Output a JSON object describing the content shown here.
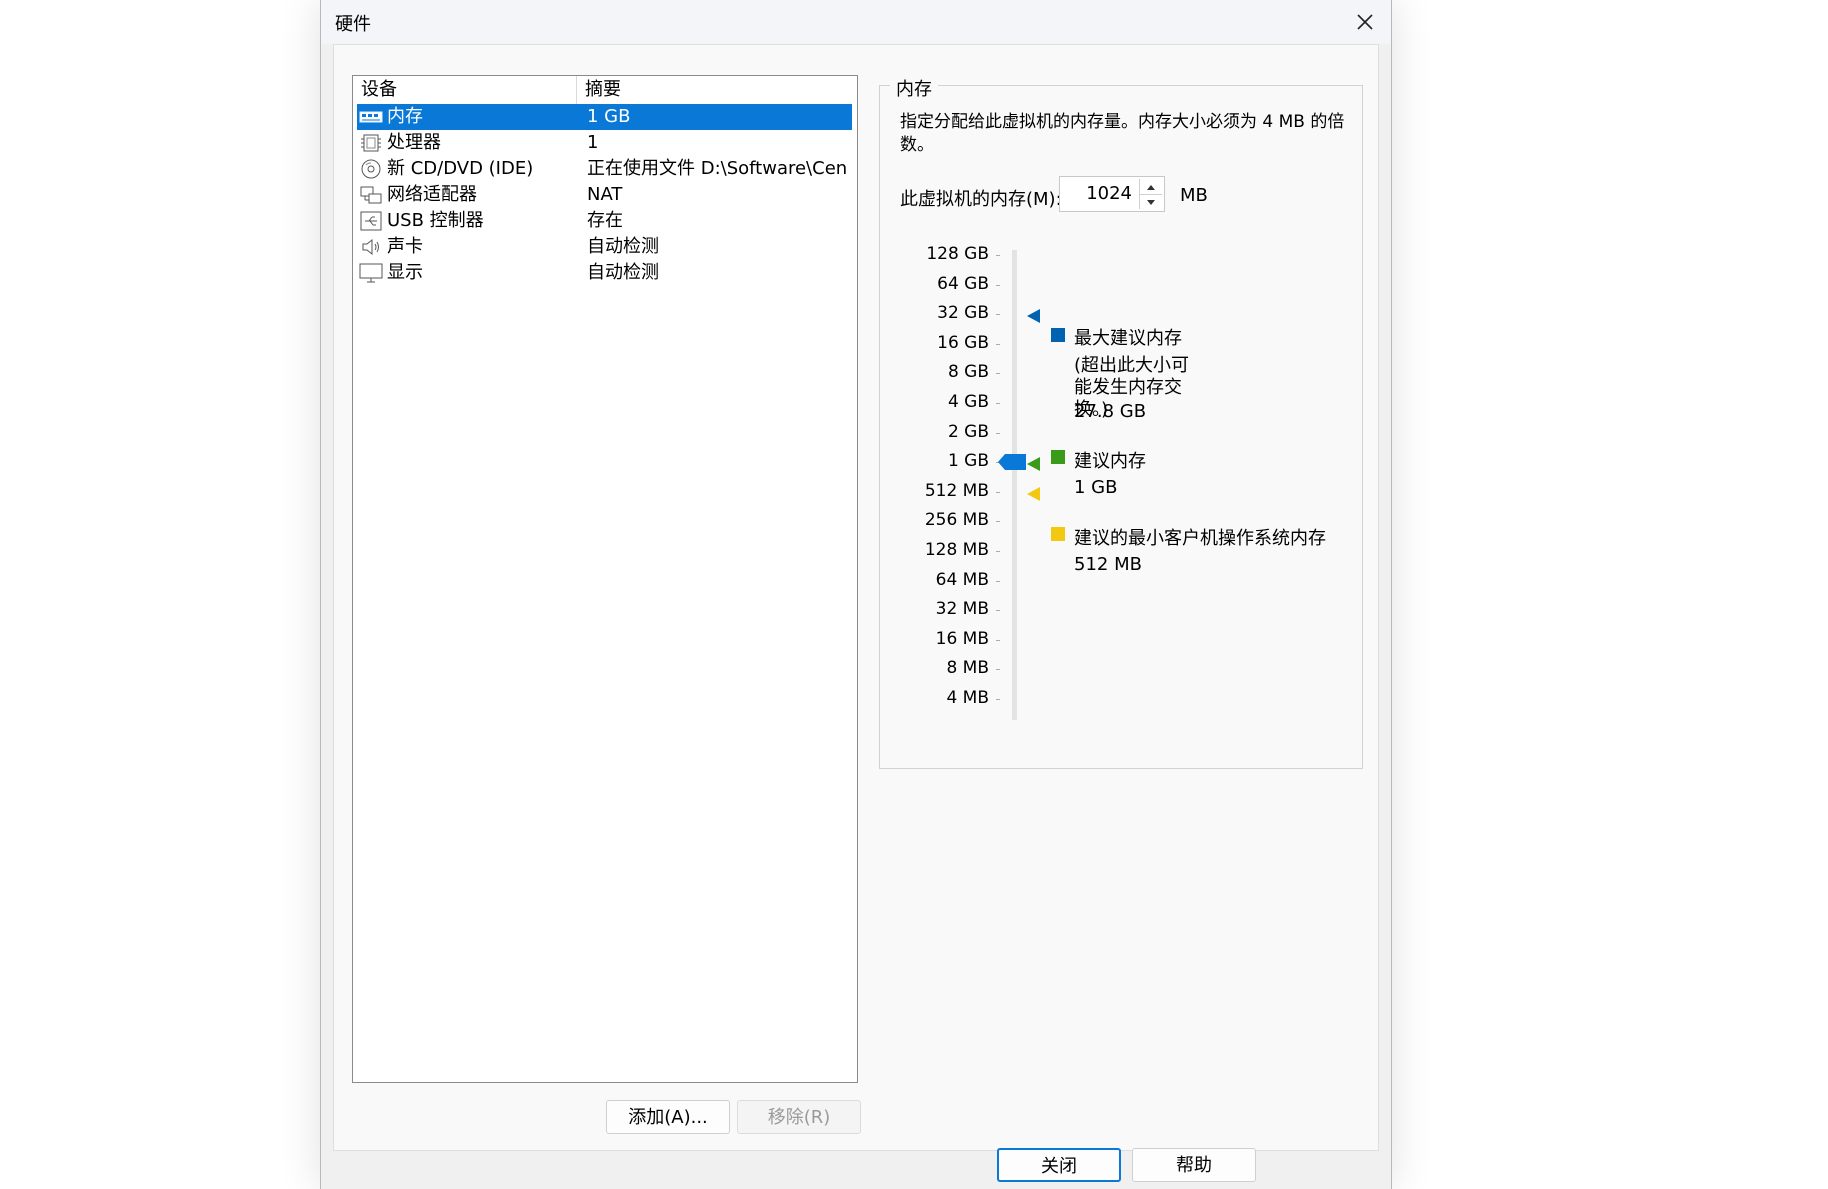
{
  "window": {
    "title": "硬件"
  },
  "device_list": {
    "col_device": "设备",
    "col_summary": "摘要",
    "items": [
      {
        "icon": "memory-icon",
        "device": "内存",
        "summary": "1 GB",
        "selected": true
      },
      {
        "icon": "processor-icon",
        "device": "处理器",
        "summary": "1",
        "selected": false
      },
      {
        "icon": "cd-dvd-icon",
        "device": "新 CD/DVD (IDE)",
        "summary": "正在使用文件 D:\\Software\\Cen...",
        "selected": false
      },
      {
        "icon": "network-adapter-icon",
        "device": "网络适配器",
        "summary": "NAT",
        "selected": false
      },
      {
        "icon": "usb-icon",
        "device": "USB 控制器",
        "summary": "存在",
        "selected": false
      },
      {
        "icon": "speaker-icon",
        "device": "声卡",
        "summary": "自动检测",
        "selected": false
      },
      {
        "icon": "monitor-icon",
        "device": "显示",
        "summary": "自动检测",
        "selected": false
      }
    ]
  },
  "buttons": {
    "add": "添加(A)...",
    "remove": "移除(R)",
    "close": "关闭",
    "help": "帮助"
  },
  "memory": {
    "group_title": "内存",
    "description": "指定分配给此虚拟机的内存量。内存大小必须为 4 MB 的倍数。",
    "field_label": "此虚拟机的内存(M):",
    "value": "1024",
    "unit": "MB",
    "scale_ticks": [
      "128 GB",
      "64 GB",
      "32 GB",
      "16 GB",
      "8 GB",
      "4 GB",
      "2 GB",
      "1 GB",
      "512 MB",
      "256 MB",
      "128 MB",
      "64 MB",
      "32 MB",
      "16 MB",
      "8 MB",
      "4 MB"
    ],
    "current_level": "1 GB",
    "legend": {
      "max": {
        "label": "最大建议内存",
        "note": "(超出此大小可能发生内存交换。)",
        "value": "27.8 GB",
        "color": "#0063b1"
      },
      "recommended": {
        "label": "建议内存",
        "value": "1 GB",
        "color": "#3a9a1a"
      },
      "min": {
        "label": "建议的最小客户机操作系统内存",
        "value": "512 MB",
        "color": "#f2c811"
      }
    },
    "slider_color": "#0a78d7"
  }
}
